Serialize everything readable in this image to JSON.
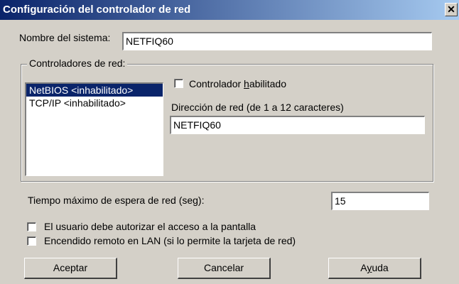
{
  "window": {
    "title": "Configuración del controlador de red",
    "close_glyph": "✕"
  },
  "system_name": {
    "label": "Nombre del sistema:",
    "value": "NETFIQ60"
  },
  "network_drivers": {
    "group_label": "Controladores de red:",
    "items": [
      {
        "label": "NetBIOS <inhabilitado>",
        "selected": true
      },
      {
        "label": "TCP/IP <inhabilitado>",
        "selected": false
      }
    ],
    "enabled_checkbox": {
      "prefix": "Controlador ",
      "mnemonic": "h",
      "suffix": "abilitado",
      "checked": false
    },
    "address_label": "Dirección de red (de 1 a 12 caracteres)",
    "address_value": "NETFIQ60"
  },
  "timeout": {
    "label": "Tiempo máximo de espera de red (seg):",
    "value": "15"
  },
  "options": [
    {
      "label": "El usuario debe autorizar el acceso a la pantalla",
      "checked": false
    },
    {
      "label": "Encendido remoto en LAN (si lo permite la tarjeta de red)",
      "checked": false
    }
  ],
  "buttons": {
    "accept": "Aceptar",
    "cancel": "Cancelar",
    "help_prefix": "A",
    "help_mnemonic": "y",
    "help_suffix": "uda"
  }
}
